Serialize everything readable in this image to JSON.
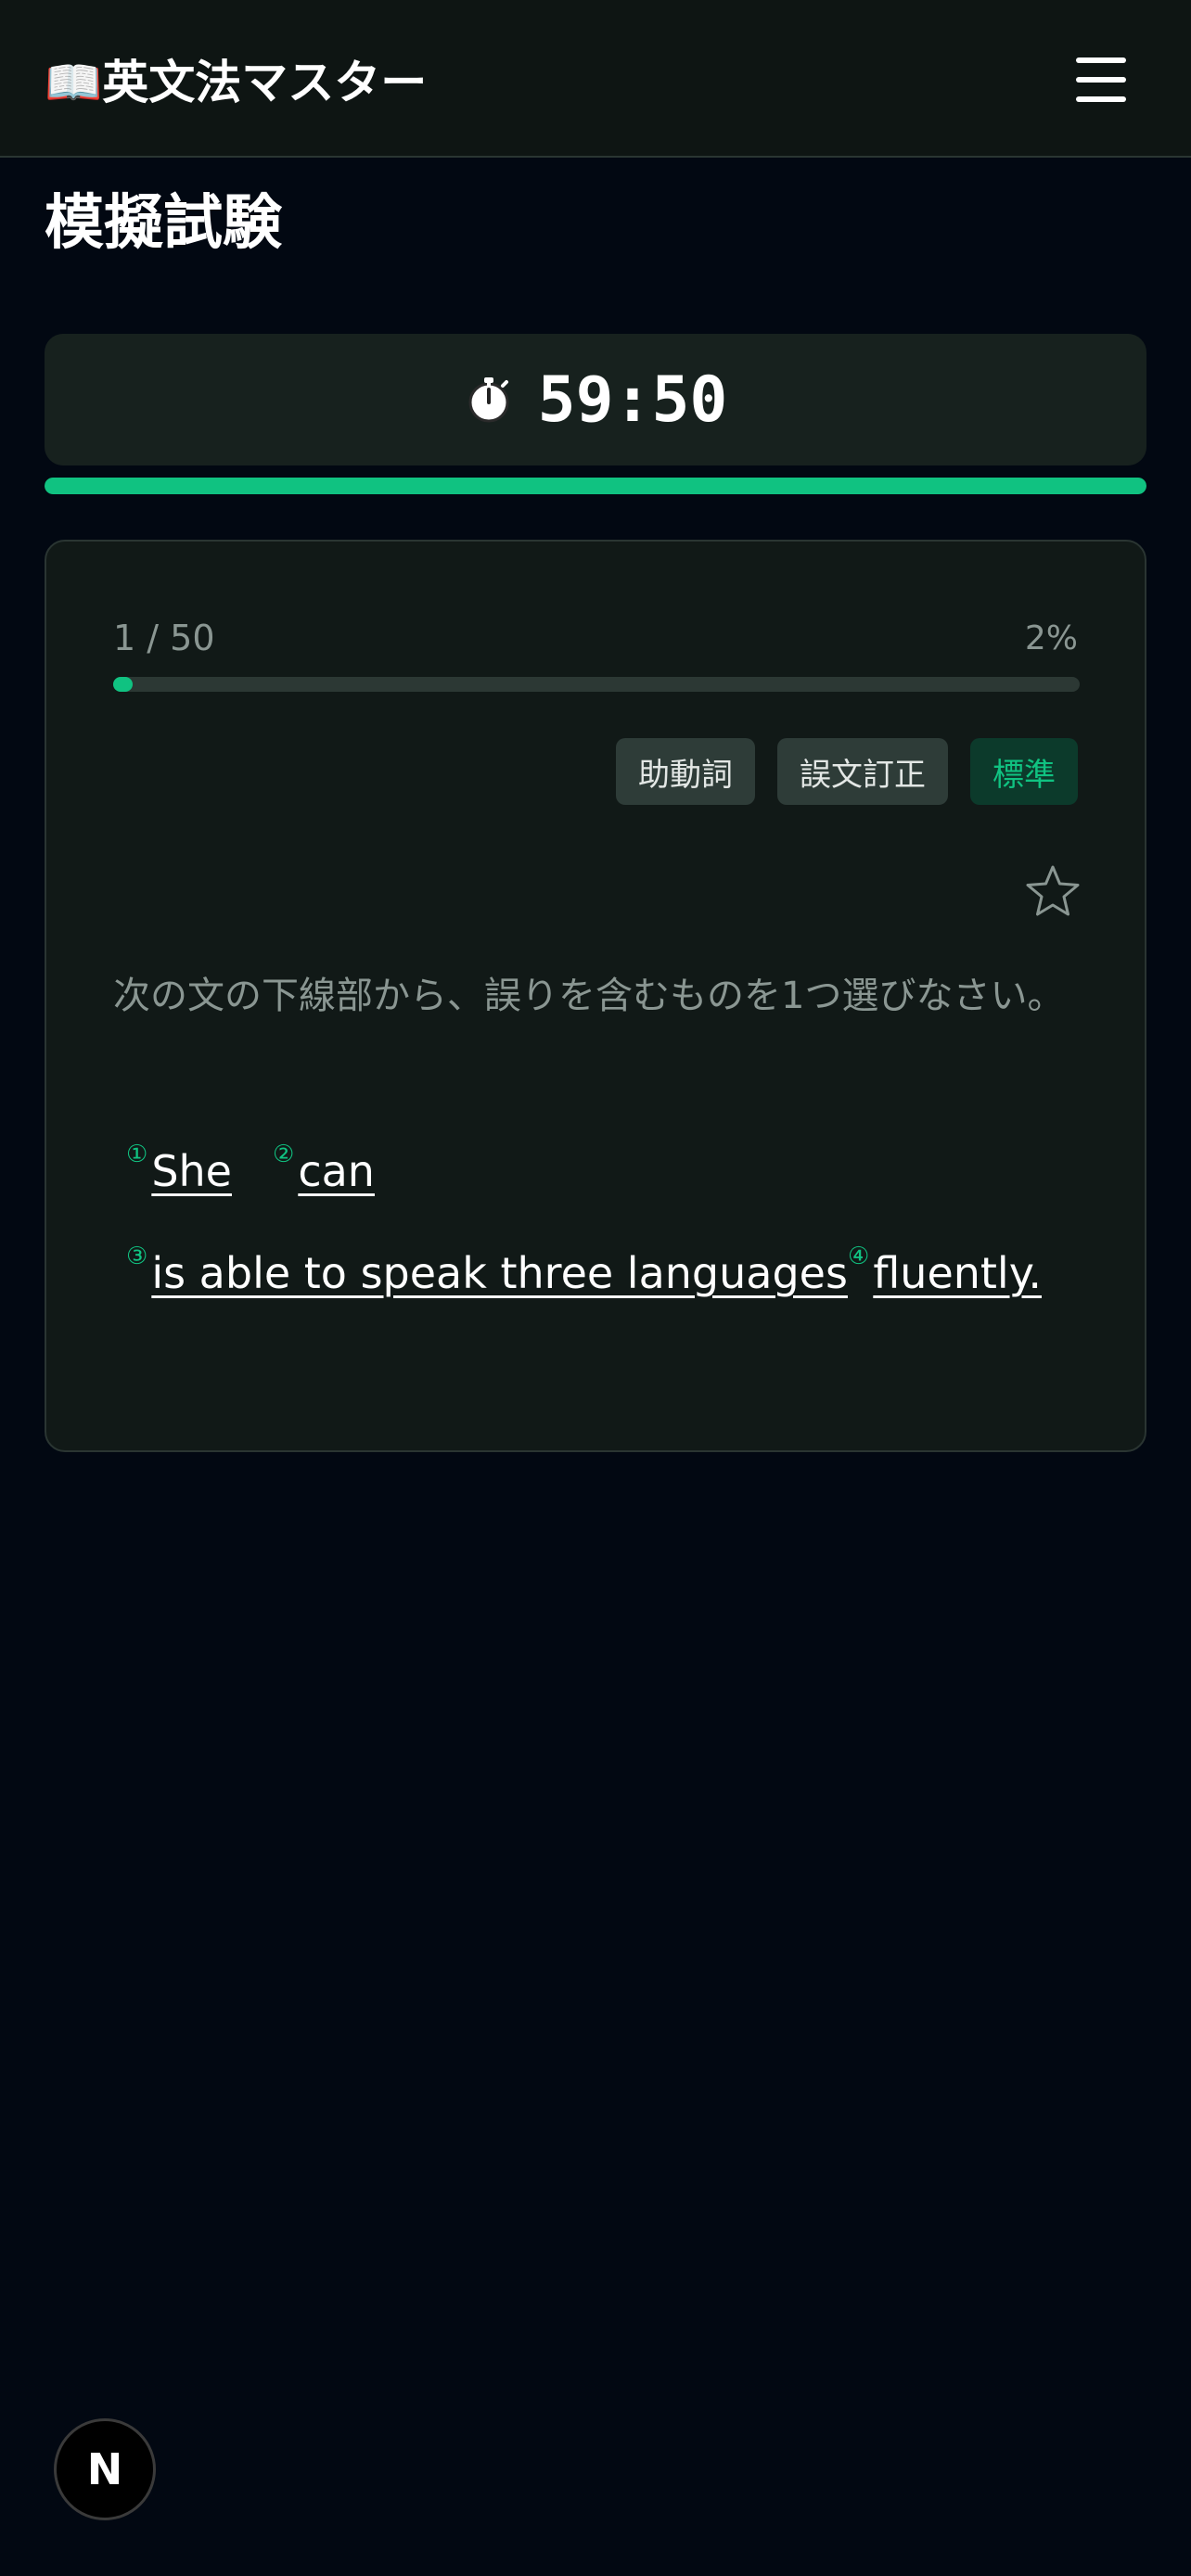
{
  "header": {
    "title": "📖英文法マスター",
    "menu_icon": "hamburger-menu-icon"
  },
  "page": {
    "title": "模擬試験"
  },
  "timer": {
    "icon": "stopwatch-icon",
    "time": "59:50",
    "remaining_fraction": 1.0,
    "bar_color": "#10c281"
  },
  "question": {
    "counter": "1 / 50",
    "percent": "2%",
    "progress_fraction": 0.02,
    "tags": [
      "助動詞",
      "誤文訂正"
    ],
    "level": "標準",
    "favorite_icon": "star-outline-icon",
    "instruction": "次の文の下線部から、誤りを含むものを1つ選びなさい。",
    "choices": [
      {
        "num": "①",
        "text": "She"
      },
      {
        "num": "②",
        "text": "can"
      },
      {
        "num": "③",
        "text": "is able to speak three languages"
      },
      {
        "num": "④",
        "text": "fluently."
      }
    ]
  },
  "footer": {
    "badge": "N"
  },
  "colors": {
    "accent": "#10c281",
    "background": "#020812",
    "card": "#111917"
  }
}
